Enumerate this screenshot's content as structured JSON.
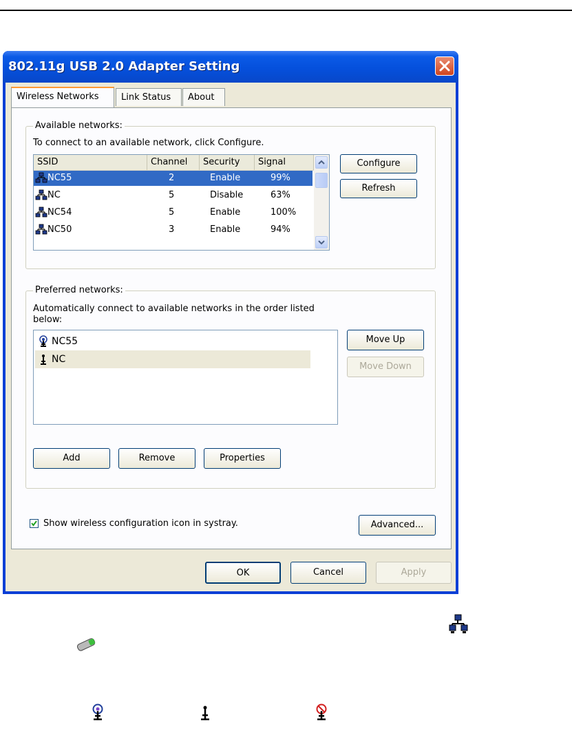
{
  "window": {
    "title": "802.11g USB 2.0 Adapter Setting"
  },
  "tabs": [
    "Wireless Networks",
    "Link Status",
    "About"
  ],
  "available": {
    "legend": "Available networks:",
    "instruction": "To connect to an available network, click Configure.",
    "columns": [
      "SSID",
      "Channel",
      "Security",
      "Signal"
    ],
    "rows": [
      {
        "ssid": "NC55",
        "channel": "2",
        "security": "Enable",
        "signal": "99%",
        "selected": true
      },
      {
        "ssid": "NC",
        "channel": "5",
        "security": "Disable",
        "signal": "63%",
        "selected": false
      },
      {
        "ssid": "NC54",
        "channel": "5",
        "security": "Enable",
        "signal": "100%",
        "selected": false
      },
      {
        "ssid": "NC50",
        "channel": "3",
        "security": "Enable",
        "signal": "94%",
        "selected": false
      }
    ],
    "configure_label": "Configure",
    "refresh_label": "Refresh"
  },
  "preferred": {
    "legend": "Preferred networks:",
    "instruction_line1": "Automatically connect to available networks in the order listed",
    "instruction_line2": "below:",
    "items": [
      {
        "name": "NC55",
        "icon": "antenna-connected-icon"
      },
      {
        "name": "NC",
        "icon": "antenna-icon"
      }
    ],
    "move_up_label": "Move Up",
    "move_down_label": "Move Down",
    "add_label": "Add",
    "remove_label": "Remove",
    "properties_label": "Properties"
  },
  "systray": {
    "checked": true,
    "label": "Show wireless configuration icon in systray."
  },
  "advanced_label": "Advanced...",
  "footer": {
    "ok_label": "OK",
    "cancel_label": "Cancel",
    "apply_label": "Apply"
  },
  "colors": {
    "title_bar": "#0550dc",
    "selection": "#316ac5",
    "dialog_face": "#ece9d8",
    "close_button": "#d0451f"
  },
  "legend_icons": [
    "network-icon",
    "usb-adapter-icon",
    "antenna-connected-icon",
    "antenna-icon",
    "antenna-disabled-icon"
  ]
}
